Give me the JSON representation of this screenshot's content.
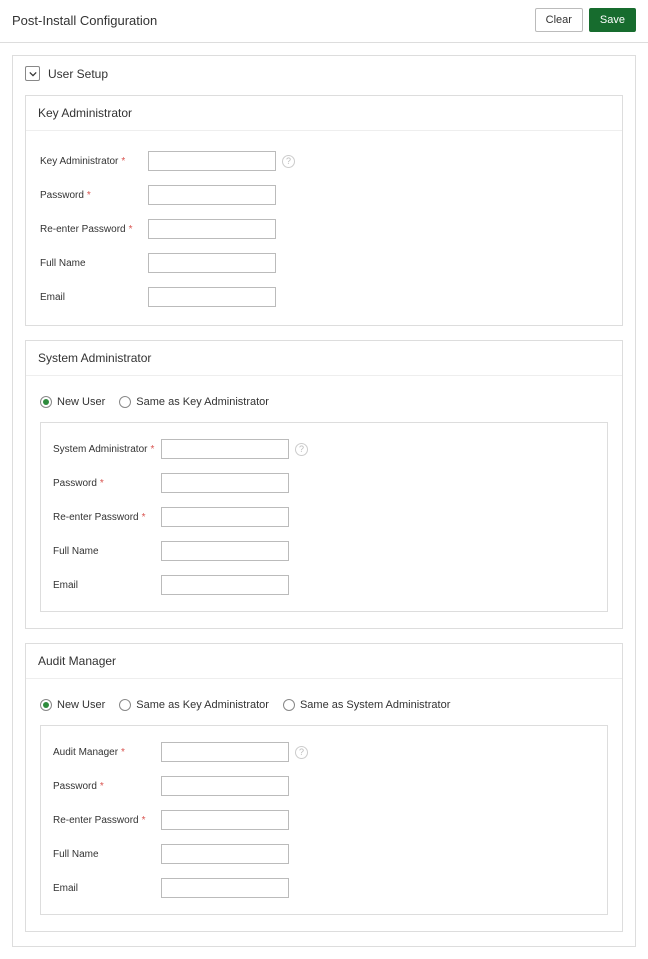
{
  "header": {
    "title": "Post-Install Configuration",
    "clear_label": "Clear",
    "save_label": "Save"
  },
  "section": {
    "title": "User Setup"
  },
  "groups": {
    "key_admin": {
      "title": "Key Administrator",
      "fields": {
        "main_label": "Key Administrator",
        "password_label": "Password",
        "reenter_label": "Re-enter Password",
        "fullname_label": "Full Name",
        "email_label": "Email"
      }
    },
    "sys_admin": {
      "title": "System Administrator",
      "radios": {
        "new_user": "New User",
        "same_key": "Same as Key Administrator"
      },
      "fields": {
        "main_label": "System Administrator",
        "password_label": "Password",
        "reenter_label": "Re-enter Password",
        "fullname_label": "Full Name",
        "email_label": "Email"
      }
    },
    "audit_mgr": {
      "title": "Audit Manager",
      "radios": {
        "new_user": "New User",
        "same_key": "Same as Key Administrator",
        "same_sys": "Same as System Administrator"
      },
      "fields": {
        "main_label": "Audit Manager",
        "password_label": "Password",
        "reenter_label": "Re-enter Password",
        "fullname_label": "Full Name",
        "email_label": "Email"
      }
    }
  }
}
